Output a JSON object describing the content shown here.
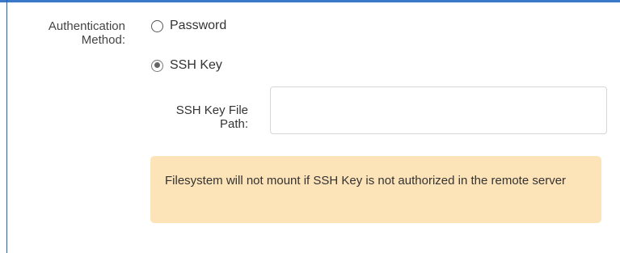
{
  "auth": {
    "label_line1": "Authentication",
    "label_line2": "Method:",
    "options": [
      {
        "label": "Password",
        "selected": false
      },
      {
        "label": "SSH Key",
        "selected": true
      }
    ]
  },
  "ssh_key_path": {
    "label_line1": "SSH Key File",
    "label_line2": "Path:",
    "value": "",
    "placeholder": ""
  },
  "warning": {
    "text": "Filesystem will not mount if SSH Key is not authorized in the remote server",
    "background": "#fde3b8"
  },
  "colors": {
    "accent_border": "#1f5fbf"
  }
}
